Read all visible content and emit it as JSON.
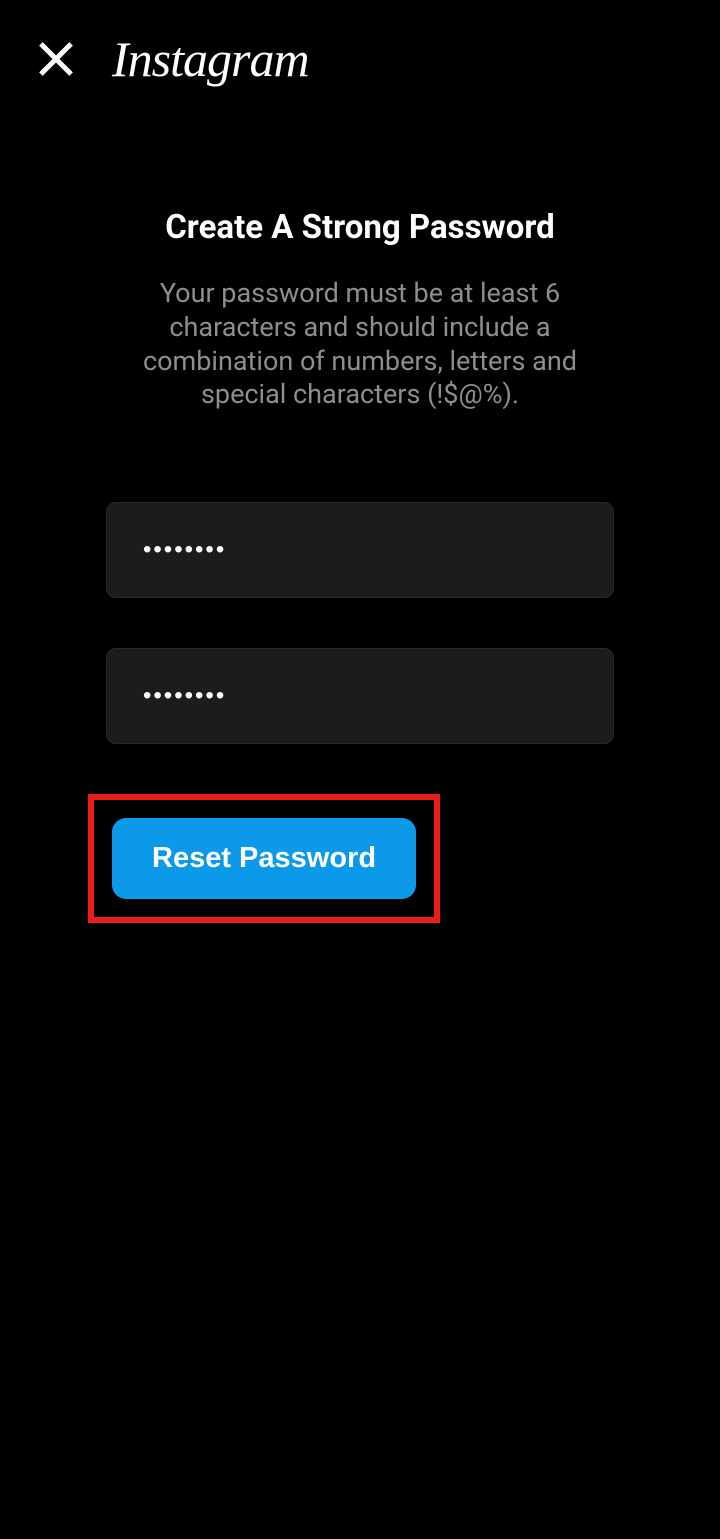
{
  "header": {
    "logo_text": "Instagram"
  },
  "content": {
    "title": "Create A Strong Password",
    "subtitle": "Your password must be at least 6 characters and should include a combination of numbers, letters and special characters (!$@%)."
  },
  "form": {
    "password_value": "••••••••",
    "confirm_password_value": "••••••••",
    "reset_button_label": "Reset Password"
  },
  "highlight": {
    "color": "#eb1c1c"
  }
}
